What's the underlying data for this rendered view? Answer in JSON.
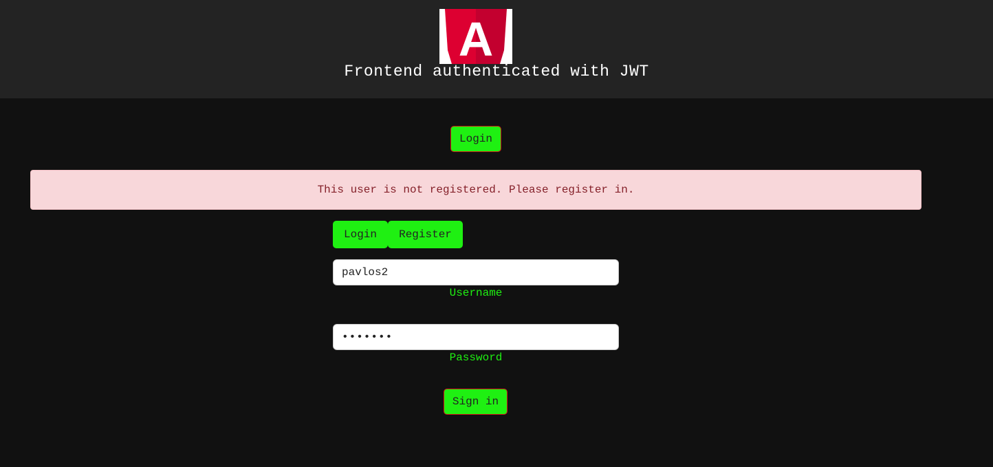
{
  "header": {
    "title": "Frontend authenticated with JWT",
    "logo_letter": "A",
    "logo_colors": {
      "left": "#dd0031",
      "right": "#c3002f",
      "letter": "#ffffff"
    }
  },
  "nav": {
    "login_label": "Login"
  },
  "alert": {
    "message": "This user is not registered. Please register in.",
    "type": "danger"
  },
  "tabs": {
    "login_label": "Login",
    "register_label": "Register"
  },
  "form": {
    "username": {
      "value": "pavlos2",
      "label": "Username"
    },
    "password": {
      "value": "•••••••",
      "label": "Password"
    },
    "submit_label": "Sign in"
  },
  "colors": {
    "accent_green": "#1ff012",
    "background": "#111111",
    "header_bg": "#232323"
  }
}
